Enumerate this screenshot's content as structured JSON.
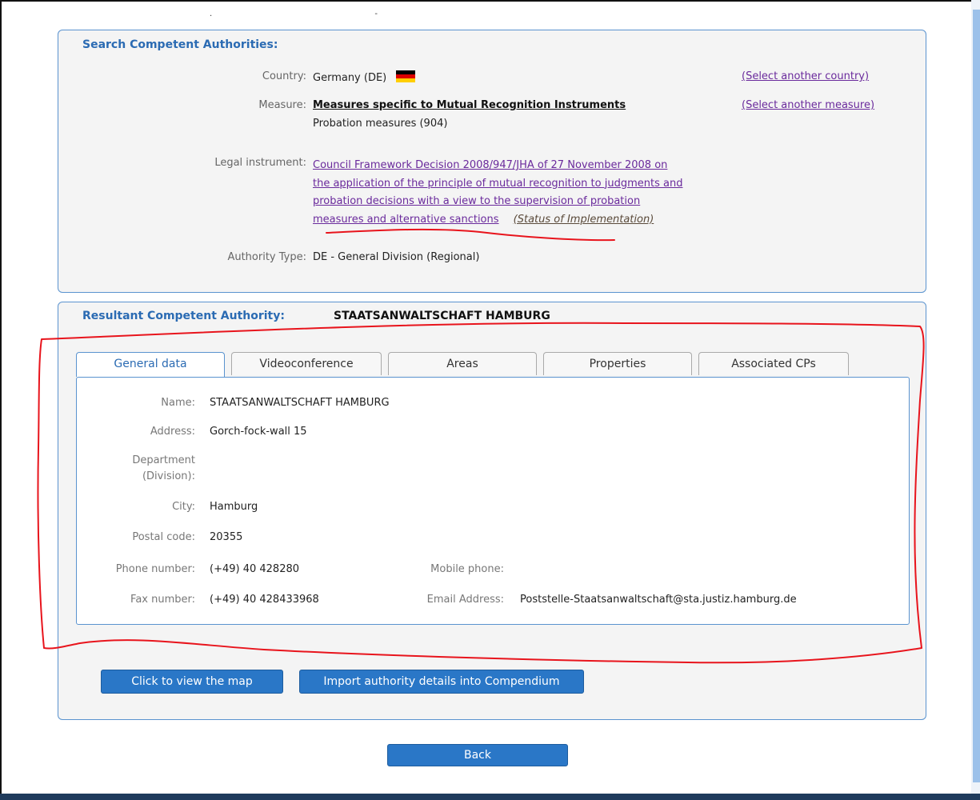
{
  "top_marks": ". -",
  "search": {
    "title": "Search Competent Authorities:",
    "country_label": "Country:",
    "country_value": "Germany (DE)",
    "select_country_link": "(Select another country)",
    "measure_label": "Measure:",
    "measure_value": "Measures specific to Mutual Recognition Instruments",
    "measure_sub": "Probation measures (904)",
    "select_measure_link": "(Select another measure)",
    "legal_label": "Legal instrument:",
    "legal_lines": [
      "Council Framework Decision 2008/947/JHA of 27 November 2008 on",
      "the application of the principle of mutual recognition to judgments and",
      "probation decisions with a view to the supervision of probation",
      "measures and alternative sanctions"
    ],
    "status_link": "(Status of Implementation)",
    "authority_type_label": "Authority Type:",
    "authority_type_value": "DE - General Division (Regional)"
  },
  "result": {
    "title": "Resultant Competent Authority:",
    "authority_name": "STAATSANWALTSCHAFT HAMBURG",
    "tabs": [
      "General data",
      "Videoconference",
      "Areas",
      "Properties",
      "Associated CPs"
    ],
    "fields": {
      "name_label": "Name:",
      "name_value": "STAATSANWALTSCHAFT HAMBURG",
      "address_label": "Address:",
      "address_value": "Gorch-fock-wall 15",
      "department_label_1": "Department",
      "department_label_2": "(Division):",
      "city_label": "City:",
      "city_value": "Hamburg",
      "postal_label": "Postal code:",
      "postal_value": "20355",
      "phone_label": "Phone number:",
      "phone_value": "(+49) 40 428280",
      "mobile_label": "Mobile phone:",
      "fax_label": "Fax number:",
      "fax_value": "(+49) 40 428433968",
      "email_label": "Email Address:",
      "email_value": "Poststelle-Staatsanwaltschaft@sta.justiz.hamburg.de"
    },
    "map_button": "Click to view the map",
    "import_button": "Import authority details into Compendium"
  },
  "back_button": "Back",
  "colors": {
    "accent": "#2b6bb3",
    "button": "#2a77c7",
    "link": "#6a2a9c",
    "annotation": "#e8141c",
    "flag": [
      "#000000",
      "#dd0000",
      "#ffce00"
    ]
  }
}
